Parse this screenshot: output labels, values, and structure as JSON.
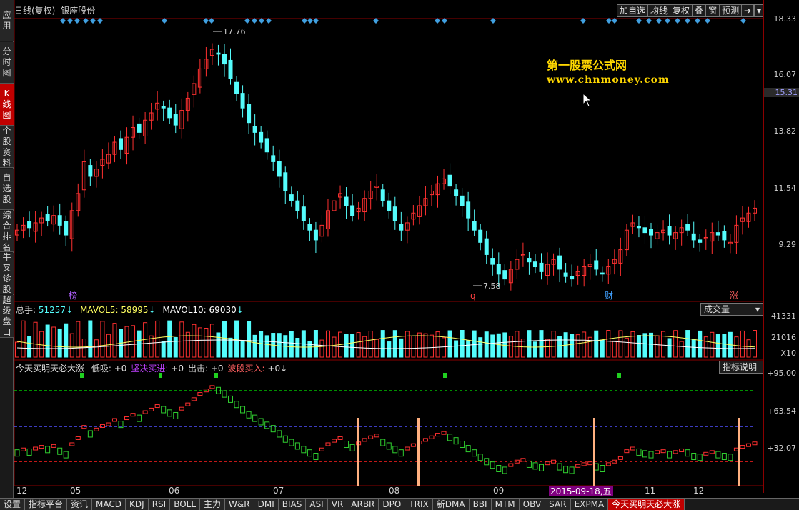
{
  "left_nav": [
    {
      "label": "应用",
      "active": false
    },
    {
      "label": "分时图",
      "active": false
    },
    {
      "label": "K线图",
      "active": true
    },
    {
      "label": "个股资料",
      "active": false
    },
    {
      "label": "自选股",
      "active": false
    },
    {
      "label": "综合排名",
      "active": false
    },
    {
      "label": "牛叉诊股",
      "active": false
    },
    {
      "label": "超级盘口",
      "active": false
    }
  ],
  "header": {
    "period": "日线(复权)",
    "stock_name": "银座股份"
  },
  "toolbar": [
    "加自选",
    "均线",
    "复权",
    "叠",
    "窗",
    "预测"
  ],
  "watermark": {
    "line1": "第一股票公式网",
    "line2": "www.chnmoney.com"
  },
  "price_axis": {
    "ticks": [
      "18.33",
      "16.07",
      "13.82",
      "11.54",
      "9.29"
    ],
    "current": "15.31"
  },
  "price_annotations": {
    "high": "17.76",
    "low": "7.58"
  },
  "event_markers": [
    {
      "label": "榜",
      "color": "#b060ff"
    },
    {
      "label": "q",
      "color": "#ff4040"
    },
    {
      "label": "财",
      "color": "#40a0ff"
    },
    {
      "label": "涨",
      "color": "#ff6060"
    }
  ],
  "volume_panel": {
    "total_label": "总手:",
    "total_value": "51257",
    "mavol5_label": "MAVOL5:",
    "mavol5_value": "58995",
    "mavol10_label": "MAVOL10:",
    "mavol10_value": "69030",
    "dropdown": "成交量",
    "ticks": [
      "41331",
      "21016",
      "X10"
    ]
  },
  "indicator_panel": {
    "name": "今天买明天必大涨",
    "items": [
      {
        "label": "低吸:",
        "value": "+0",
        "color": "#d0d0d0"
      },
      {
        "label": "坚决买进:",
        "value": "+0",
        "color": "#c040ff"
      },
      {
        "label": "出击:",
        "value": "+0",
        "color": "#d0d0d0"
      },
      {
        "label": "波段买入:",
        "value": "+0",
        "color": "#ff6060"
      }
    ],
    "help_button": "指标说明",
    "ticks": [
      "+95.00",
      "+63.54",
      "+32.07"
    ]
  },
  "time_axis": [
    "12",
    "05",
    "06",
    "07",
    "08",
    "09",
    "11",
    "12"
  ],
  "date_tip": "2015-09-18,五",
  "bottom_tabs": [
    {
      "label": "设置",
      "active": false
    },
    {
      "label": "指标平台",
      "active": false
    },
    {
      "label": "资讯",
      "active": false
    },
    {
      "label": "MACD",
      "active": false
    },
    {
      "label": "KDJ",
      "active": false
    },
    {
      "label": "RSI",
      "active": false
    },
    {
      "label": "BOLL",
      "active": false
    },
    {
      "label": "主力",
      "active": false
    },
    {
      "label": "W&R",
      "active": false
    },
    {
      "label": "DMI",
      "active": false
    },
    {
      "label": "BIAS",
      "active": false
    },
    {
      "label": "ASI",
      "active": false
    },
    {
      "label": "VR",
      "active": false
    },
    {
      "label": "ARBR",
      "active": false
    },
    {
      "label": "DPO",
      "active": false
    },
    {
      "label": "TRIX",
      "active": false
    },
    {
      "label": "新DMA",
      "active": false
    },
    {
      "label": "BBI",
      "active": false
    },
    {
      "label": "MTM",
      "active": false
    },
    {
      "label": "OBV",
      "active": false
    },
    {
      "label": "SAR",
      "active": false
    },
    {
      "label": "EXPMA",
      "active": false
    },
    {
      "label": "今天买明天必大涨",
      "active": true
    }
  ],
  "colors": {
    "up": "#ff3030",
    "down": "#54fcfc",
    "grid": "#8b0000",
    "green_line": "#00c000",
    "blue_line": "#5050ff",
    "red_line": "#ff2020"
  },
  "chart_data": {
    "type": "candlestick",
    "price_range": [
      7.58,
      18.33
    ],
    "closes": [
      10.0,
      10.2,
      10.1,
      10.3,
      10.5,
      10.4,
      10.6,
      10.2,
      9.8,
      10.8,
      11.5,
      12.8,
      12.2,
      12.5,
      12.9,
      13.1,
      13.6,
      13.3,
      13.8,
      14.2,
      14.0,
      14.5,
      14.8,
      15.2,
      15.0,
      14.6,
      14.3,
      14.9,
      15.4,
      16.0,
      16.6,
      17.0,
      17.4,
      17.2,
      16.8,
      16.2,
      15.6,
      15.0,
      14.4,
      14.0,
      13.6,
      13.2,
      12.8,
      12.2,
      11.6,
      11.2,
      10.8,
      10.4,
      10.0,
      9.6,
      10.2,
      10.8,
      11.2,
      11.5,
      11.0,
      10.6,
      10.9,
      11.3,
      11.6,
      11.8,
      11.2,
      10.8,
      10.4,
      10.0,
      10.3,
      10.7,
      11.0,
      11.3,
      11.6,
      11.9,
      12.1,
      11.8,
      11.4,
      11.0,
      10.5,
      10.0,
      9.5,
      9.0,
      8.6,
      8.2,
      8.0,
      8.4,
      8.8,
      9.0,
      8.7,
      8.5,
      8.3,
      8.6,
      8.8,
      8.4,
      8.1,
      8.0,
      8.3,
      8.5,
      8.6,
      8.4,
      8.2,
      8.5,
      8.8,
      9.2,
      10.0,
      10.3,
      10.1,
      9.9,
      9.8,
      9.9,
      10.0,
      9.8,
      9.9,
      10.1,
      10.0,
      9.6,
      9.5,
      9.7,
      9.9,
      9.8,
      9.6,
      9.5,
      10.2,
      10.5,
      10.7,
      10.9
    ]
  }
}
